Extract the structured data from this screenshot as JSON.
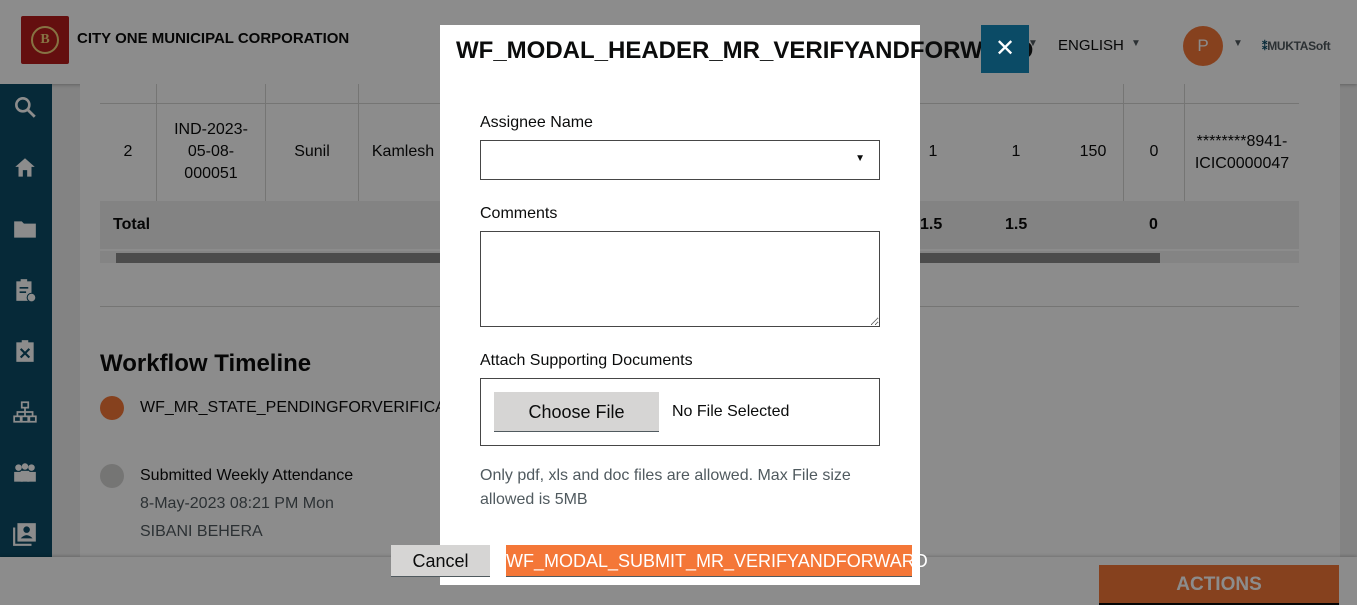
{
  "header": {
    "corporation_name": "CITY ONE MUNICIPAL CORPORATION",
    "logo_letter": "B",
    "language": "ENGLISH",
    "user_initial": "P",
    "brand_mark": "⁑",
    "brand_name": "MUKTASoft"
  },
  "sidebar": {
    "items": [
      {
        "icon": "search-icon"
      },
      {
        "icon": "home-icon"
      },
      {
        "icon": "folder-icon"
      },
      {
        "icon": "clipboard-icon"
      },
      {
        "icon": "tools-clipboard-icon"
      },
      {
        "icon": "org-chart-icon"
      },
      {
        "icon": "people-icon"
      },
      {
        "icon": "contact-card-icon"
      }
    ]
  },
  "table": {
    "row": {
      "sno": "2",
      "id_line1": "IND-2023-",
      "id_line2": "05-08-",
      "id_line3": "000051",
      "name": "Sunil",
      "guardian": "Kamlesh",
      "col_a": "1",
      "col_b": "1",
      "col_c": "150",
      "col_d": "0",
      "account_line1": "********8941-",
      "account_line2": "ICIC0000047"
    },
    "total": {
      "label": "Total",
      "col_a": "1.5",
      "col_b": "1.5",
      "col_d": "0"
    }
  },
  "workflow": {
    "title": "Workflow Timeline",
    "current_state": "WF_MR_STATE_PENDINGFORVERIFICATION",
    "event": {
      "title": "Submitted Weekly Attendance",
      "date": "8-May-2023 08:21 PM Mon",
      "user": "SIBANI BEHERA"
    },
    "colors": {
      "current": "#f47738",
      "past": "#d6d5d4"
    }
  },
  "footer": {
    "actions_label": "ACTIONS"
  },
  "modal": {
    "title": "WF_MODAL_HEADER_MR_VERIFYANDFORWARD",
    "assignee_label": "Assignee Name",
    "assignee_value": "",
    "comments_label": "Comments",
    "comments_value": "",
    "attach_label": "Attach Supporting Documents",
    "choose_file_label": "Choose File",
    "no_file_text": "No File Selected",
    "hint": "Only pdf, xls and doc files are allowed. Max File size allowed is 5MB",
    "cancel_label": "Cancel",
    "submit_label": "WF_MODAL_SUBMIT_MR_VERIFYANDFORWARD",
    "close_icon": "close-icon"
  },
  "colors": {
    "accent": "#f47738",
    "primary": "#0b4b66",
    "overlay": "rgba(0,0,0,0.45)"
  }
}
